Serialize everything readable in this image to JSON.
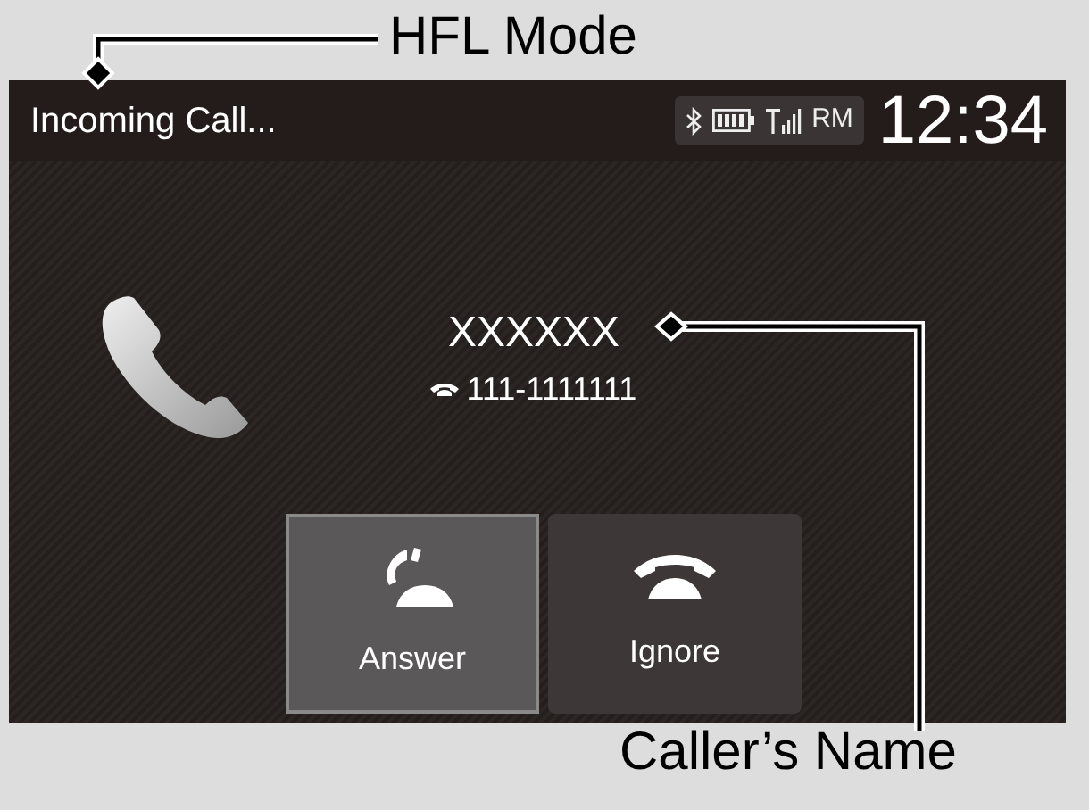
{
  "callouts": [
    {
      "label": "HFL Mode"
    },
    {
      "label": "Caller’s Name"
    }
  ],
  "header": {
    "title": "Incoming Call...",
    "status": "RM",
    "time": "12:34"
  },
  "caller": {
    "name": "XXXXXX",
    "number": "111-1111111"
  },
  "buttons": [
    {
      "label": "Answer",
      "kind": "answer",
      "selected": true
    },
    {
      "label": "Ignore",
      "kind": "ignore",
      "selected": false
    }
  ]
}
